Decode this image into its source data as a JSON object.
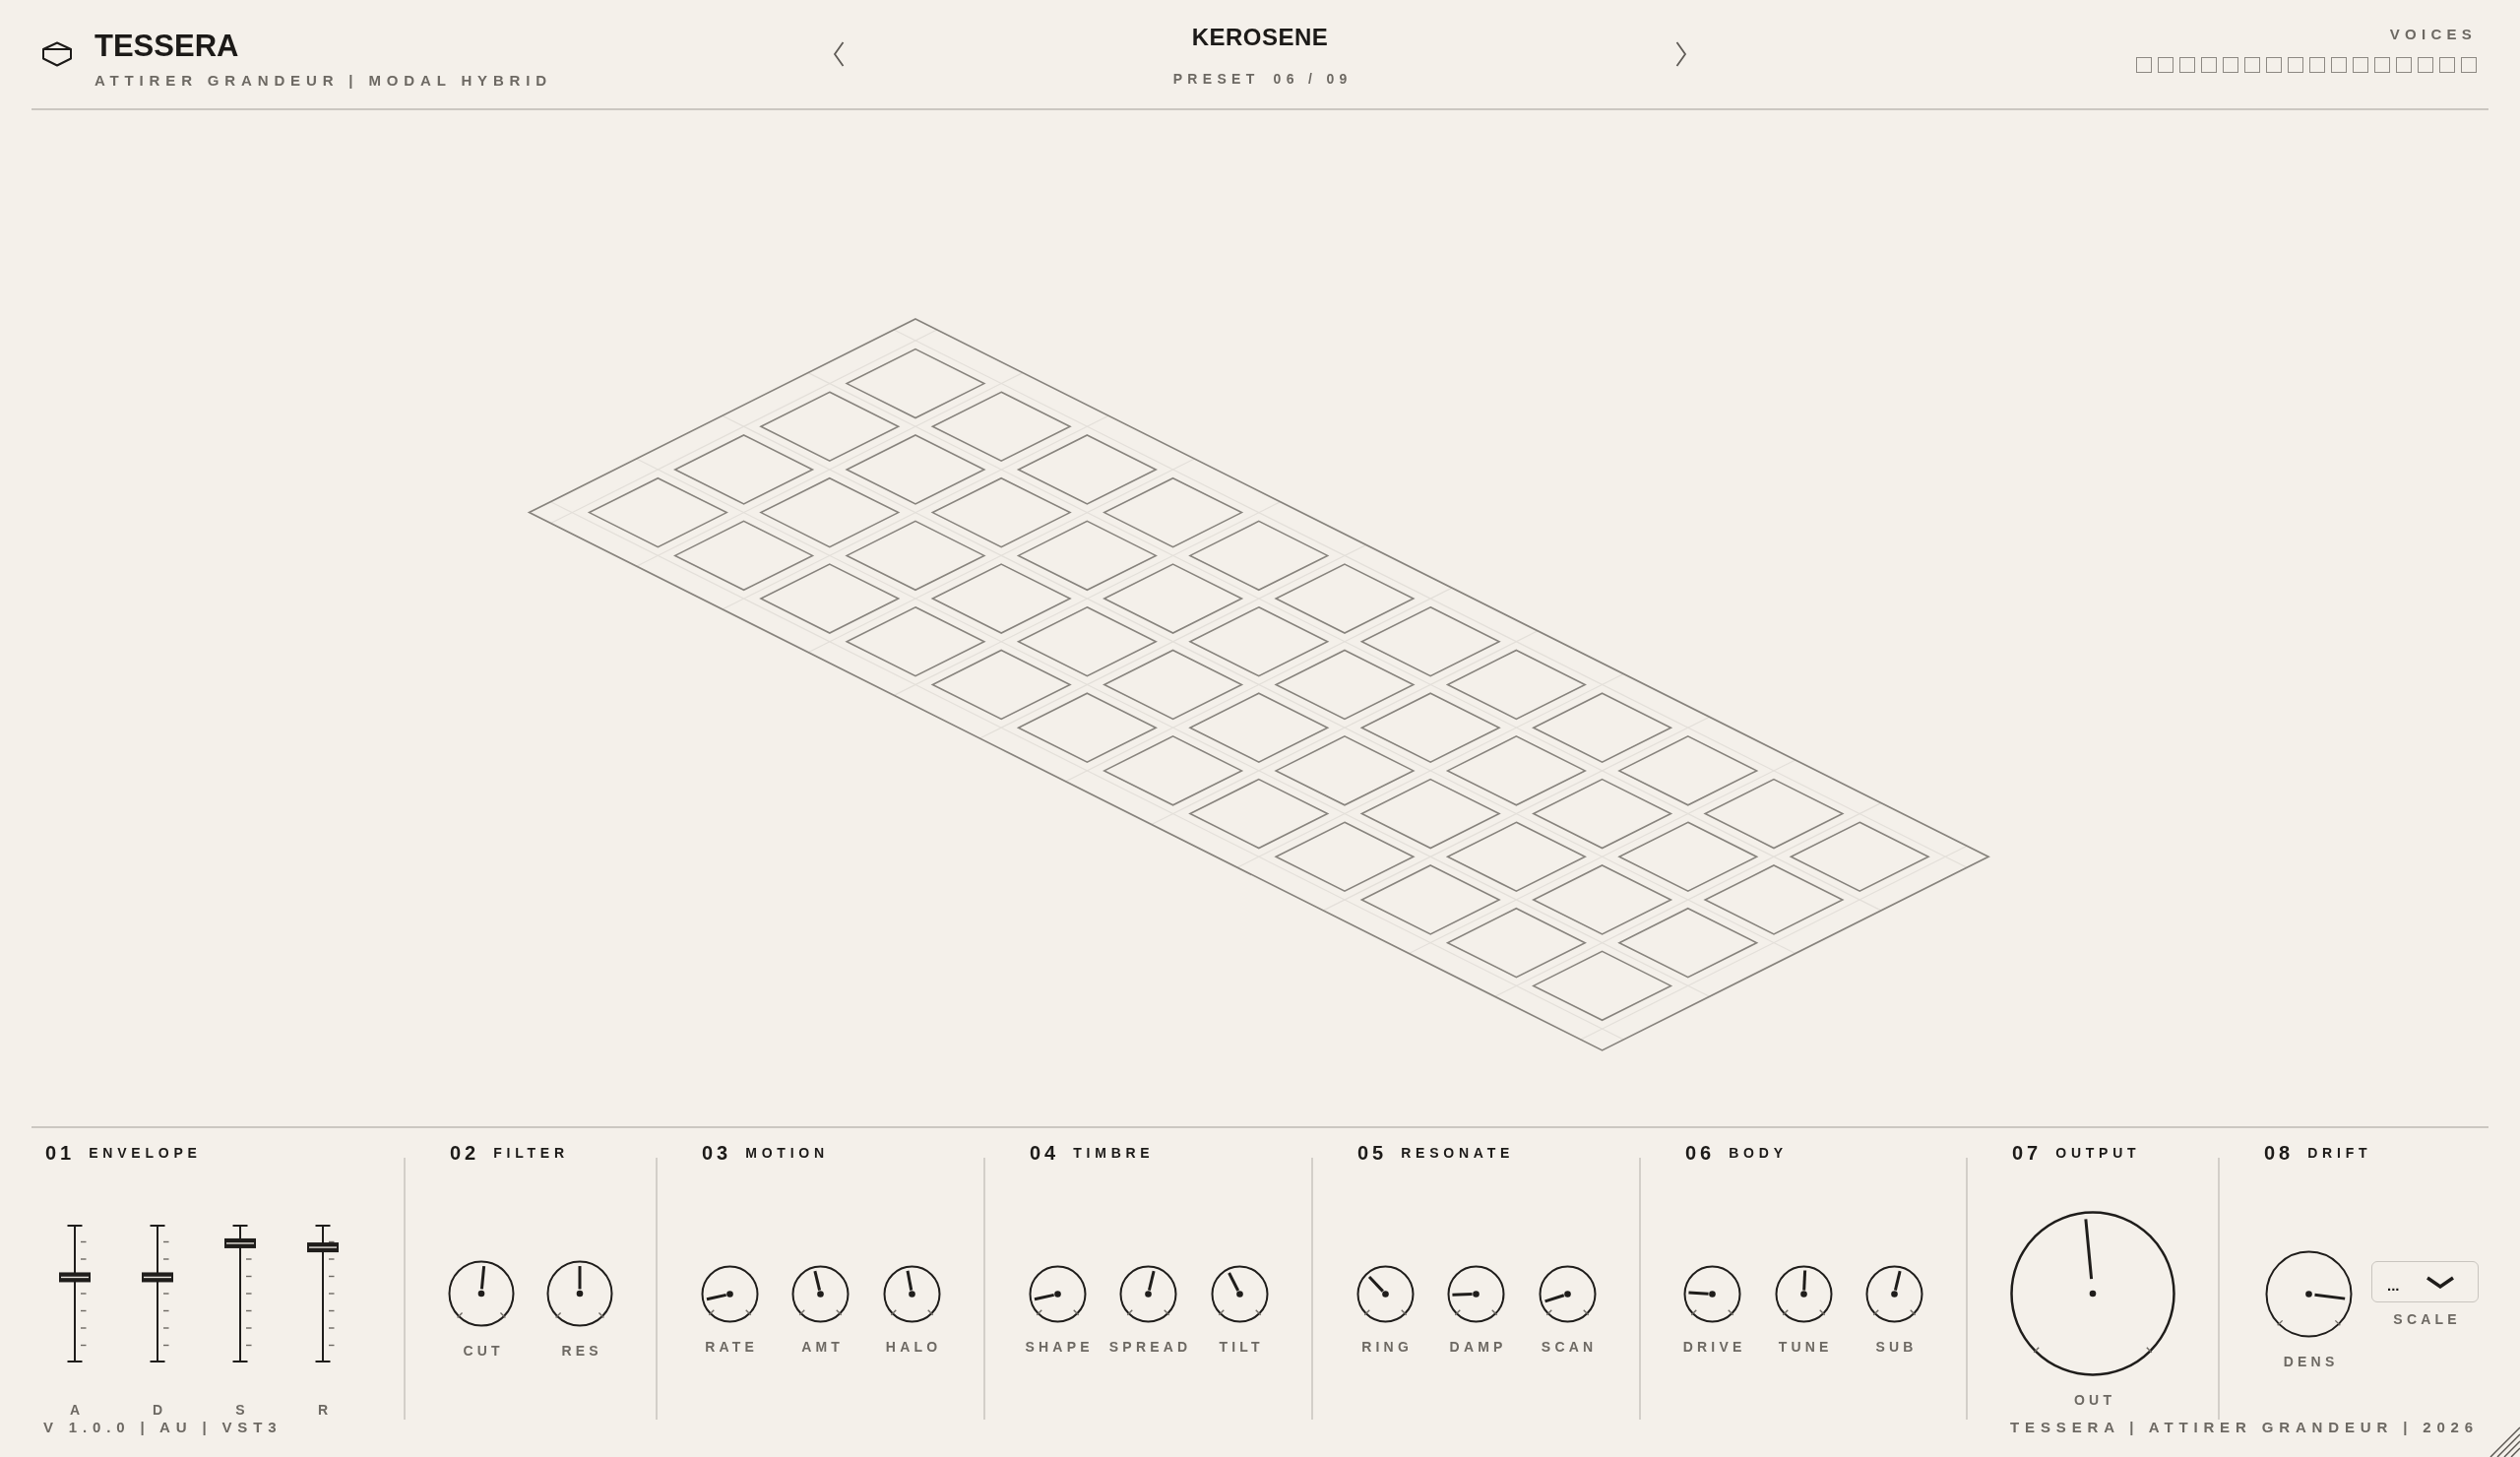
{
  "header": {
    "title": "TESSERA",
    "subtitle": "ATTIRER GRANDEUR | MODAL HYBRID"
  },
  "preset": {
    "name": "KEROSENE",
    "label": "PRESET",
    "counter": "06 / 09"
  },
  "voices": {
    "label": "VOICES",
    "slots": [
      {
        "active": false
      },
      {
        "active": false
      },
      {
        "active": false
      },
      {
        "active": false
      },
      {
        "active": false
      },
      {
        "active": false
      },
      {
        "active": false
      },
      {
        "active": false
      },
      {
        "active": false
      },
      {
        "active": false
      },
      {
        "active": false
      },
      {
        "active": false
      },
      {
        "active": false
      },
      {
        "active": false
      },
      {
        "active": false
      },
      {
        "active": false
      }
    ]
  },
  "sections": [
    {
      "number": "01",
      "title": "ENVELOPE",
      "controls": [
        {
          "kind": "fader",
          "label": "A",
          "level": 0.62
        },
        {
          "kind": "fader",
          "label": "D",
          "level": 0.62
        },
        {
          "kind": "fader",
          "label": "S",
          "level": 0.87
        },
        {
          "kind": "fader",
          "label": "R",
          "level": 0.84
        }
      ]
    },
    {
      "number": "02",
      "title": "FILTER",
      "controls": [
        {
          "kind": "knob",
          "label": "CUT",
          "level": 0.52
        },
        {
          "kind": "knob",
          "label": "RES",
          "level": 0.5
        }
      ]
    },
    {
      "number": "03",
      "title": "MOTION",
      "controls": [
        {
          "kind": "knob",
          "label": "RATE",
          "level": 0.12
        },
        {
          "kind": "knob",
          "label": "AMT",
          "level": 0.45
        },
        {
          "kind": "knob",
          "label": "HALO",
          "level": 0.46
        }
      ]
    },
    {
      "number": "04",
      "title": "TIMBRE",
      "controls": [
        {
          "kind": "knob",
          "label": "SHAPE",
          "level": 0.12
        },
        {
          "kind": "knob",
          "label": "SPREAD",
          "level": 0.55
        },
        {
          "kind": "knob",
          "label": "TILT",
          "level": 0.4
        }
      ]
    },
    {
      "number": "05",
      "title": "RESONATE",
      "controls": [
        {
          "kind": "knob",
          "label": "RING",
          "level": 0.34
        },
        {
          "kind": "knob",
          "label": "DAMP",
          "level": 0.16
        },
        {
          "kind": "knob",
          "label": "SCAN",
          "level": 0.1
        }
      ]
    },
    {
      "number": "06",
      "title": "BODY",
      "controls": [
        {
          "kind": "knob",
          "label": "DRIVE",
          "level": 0.18
        },
        {
          "kind": "knob",
          "label": "TUNE",
          "level": 0.51
        },
        {
          "kind": "knob",
          "label": "SUB",
          "level": 0.55
        }
      ]
    },
    {
      "number": "07",
      "title": "OUTPUT",
      "controls": [
        {
          "kind": "knob",
          "label": "OUT",
          "level": 0.48
        }
      ]
    },
    {
      "number": "08",
      "title": "DRIFT",
      "controls": [
        {
          "kind": "knob",
          "label": "DENS",
          "level": 0.86
        },
        {
          "kind": "dropdown",
          "label": "SCALE",
          "value": "..."
        }
      ]
    }
  ],
  "footer": {
    "version": "V 1.0.0 | AU | VST3",
    "credit": "TESSERA | ATTIRER GRANDEUR | 2026"
  }
}
